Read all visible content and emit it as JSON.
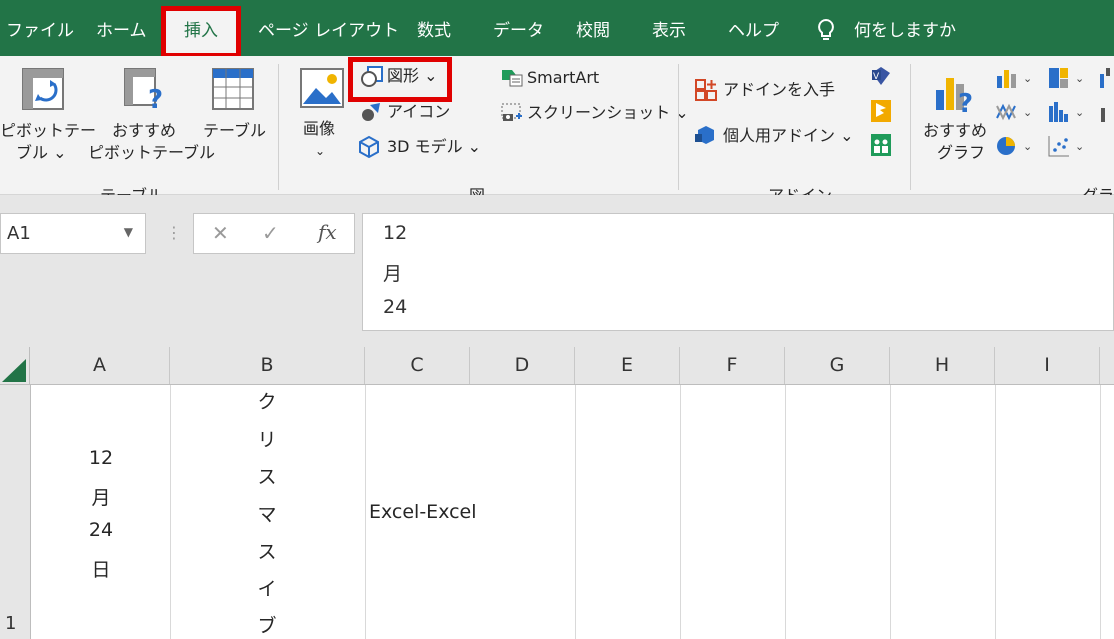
{
  "menu": {
    "tabs": [
      "ファイル",
      "ホーム",
      "挿入",
      "ページ レイアウト",
      "数式",
      "データ",
      "校閲",
      "表示",
      "ヘルプ"
    ],
    "active_tab": "挿入",
    "search_hint": "何をしますか"
  },
  "ribbon": {
    "pivot_table": [
      "ピボットテー",
      "ブル ⌄"
    ],
    "recommended_pivot": [
      "おすすめ",
      "ピボットテーブル"
    ],
    "table": "テーブル",
    "group_tables": "テーブル",
    "image": [
      "画像",
      "⌄"
    ],
    "shapes": "図形 ⌄",
    "icons": "アイコン",
    "model3d": "3D モデル ⌄",
    "smartart": "SmartArt",
    "screenshot": "スクリーンショット ⌄",
    "group_illust": "図",
    "get_addins": "アドインを入手",
    "my_addins": "個人用アドイン ⌄",
    "group_addins": "アドイン",
    "recommended_charts": [
      "おすすめ",
      "グラフ"
    ],
    "group_charts": "グラフ"
  },
  "formula_bar": {
    "name_box": "A1",
    "lines": [
      "12",
      "月",
      "24"
    ]
  },
  "grid": {
    "columns": [
      "A",
      "B",
      "C",
      "D",
      "E",
      "F",
      "G",
      "H",
      "I"
    ],
    "row_number": "1",
    "a1_lines": [
      "12",
      "月",
      "24",
      "日"
    ],
    "b1_chars": [
      "ク",
      "リ",
      "ス",
      "マ",
      "ス",
      "イ",
      "ブ"
    ],
    "c1_value": "Excel-Excel"
  },
  "colors": {
    "title_green": "#227447",
    "highlight_red": "#e00000"
  }
}
